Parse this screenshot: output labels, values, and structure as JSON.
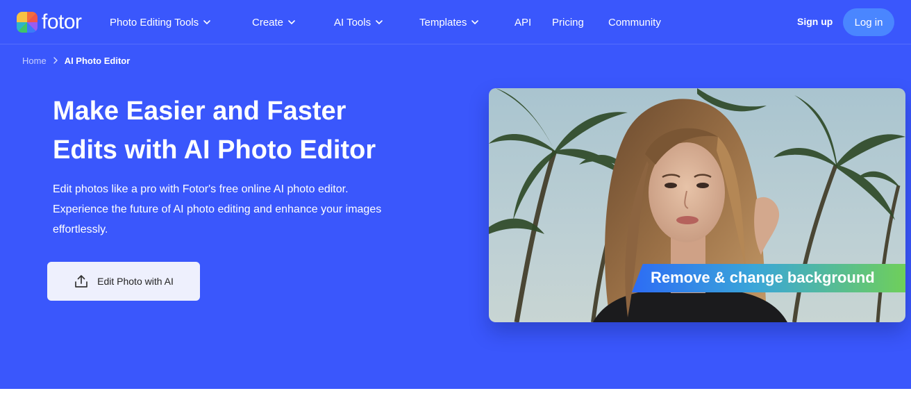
{
  "brand": {
    "name": "fotor"
  },
  "nav": {
    "items": [
      {
        "label": "Photo Editing Tools",
        "has_dropdown": true
      },
      {
        "label": "Create",
        "has_dropdown": true
      },
      {
        "label": "AI Tools",
        "has_dropdown": true
      },
      {
        "label": "Templates",
        "has_dropdown": true
      },
      {
        "label": "API",
        "has_dropdown": false
      },
      {
        "label": "Pricing",
        "has_dropdown": false
      },
      {
        "label": "Community",
        "has_dropdown": false
      }
    ],
    "signup_label": "Sign up",
    "login_label": "Log in"
  },
  "breadcrumb": {
    "home": "Home",
    "current": "AI Photo Editor"
  },
  "hero": {
    "headline_line1": "Make Easier and Faster",
    "headline_line2": "Edits with AI Photo Editor",
    "sub_line1": "Edit photos like a pro with Fotor's free online AI photo editor.",
    "sub_line2": "Experience the future of AI photo editing and enhance your images",
    "sub_line3": "effortlessly.",
    "cta_label": "Edit Photo with AI",
    "cta_icon": "upload-icon"
  },
  "showcase": {
    "badge_text": "Remove & change background"
  },
  "colors": {
    "hero_bg": "#3a57fc",
    "login_bg": "#4a86ff",
    "cta_bg": "#eef0fd"
  }
}
